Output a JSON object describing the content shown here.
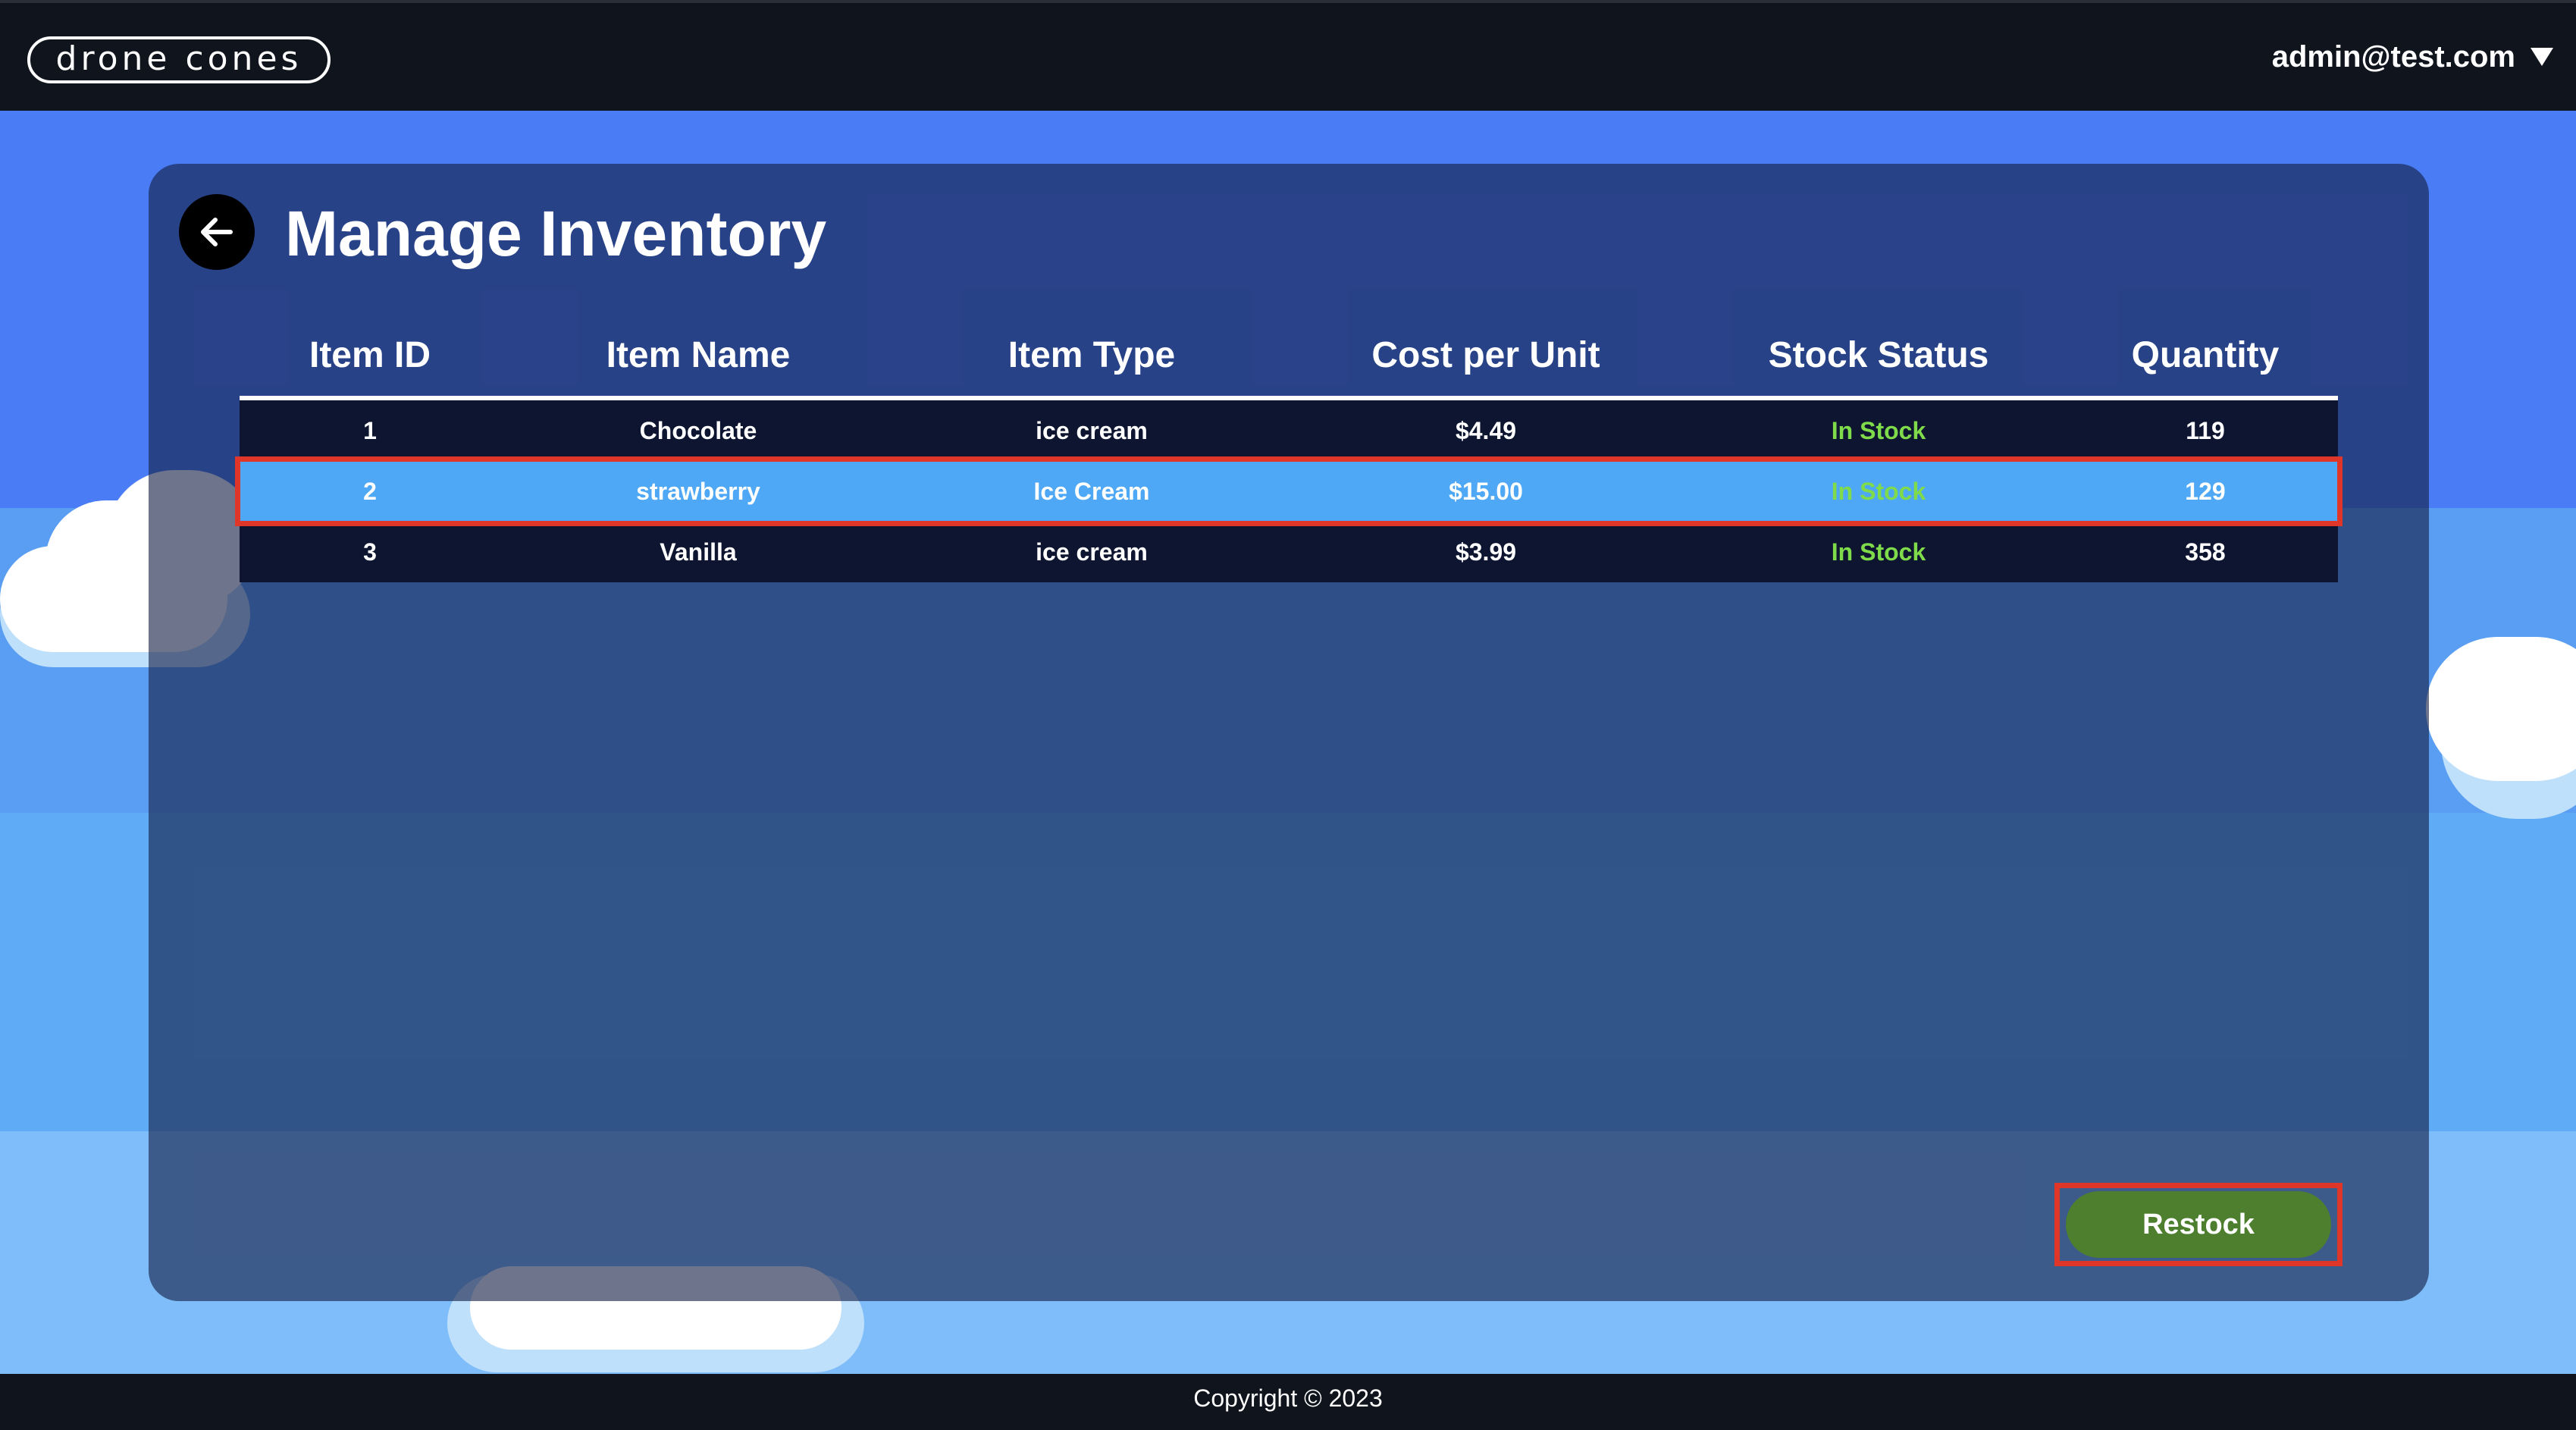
{
  "header": {
    "logo_text": "drone cones",
    "user_email": "admin@test.com",
    "user_menu_icon": "chevron-down-icon"
  },
  "page": {
    "title": "Manage Inventory",
    "back_icon": "arrow-left-icon"
  },
  "inventory_table": {
    "columns": [
      "Item ID",
      "Item Name",
      "Item Type",
      "Cost per Unit",
      "Stock Status",
      "Quantity"
    ],
    "rows": [
      {
        "id": "1",
        "name": "Chocolate",
        "type": "ice cream",
        "cost": "$4.49",
        "status": "In Stock",
        "quantity": "119",
        "selected": false
      },
      {
        "id": "2",
        "name": "strawberry",
        "type": "Ice Cream",
        "cost": "$15.00",
        "status": "In Stock",
        "quantity": "129",
        "selected": true
      },
      {
        "id": "3",
        "name": "Vanilla",
        "type": "ice cream",
        "cost": "$3.99",
        "status": "In Stock",
        "quantity": "358",
        "selected": false
      }
    ]
  },
  "actions": {
    "restock_label": "Restock"
  },
  "footer": {
    "copyright": "Copyright © 2023"
  },
  "colors": {
    "header_bg": "#10141d",
    "sky": "#4a7df5",
    "panel": "#1b2a5c",
    "selected_row": "#4ea8f6",
    "highlight_border": "#e0362a",
    "in_stock": "#7fdb4a",
    "restock_button": "#4e7f2e"
  }
}
